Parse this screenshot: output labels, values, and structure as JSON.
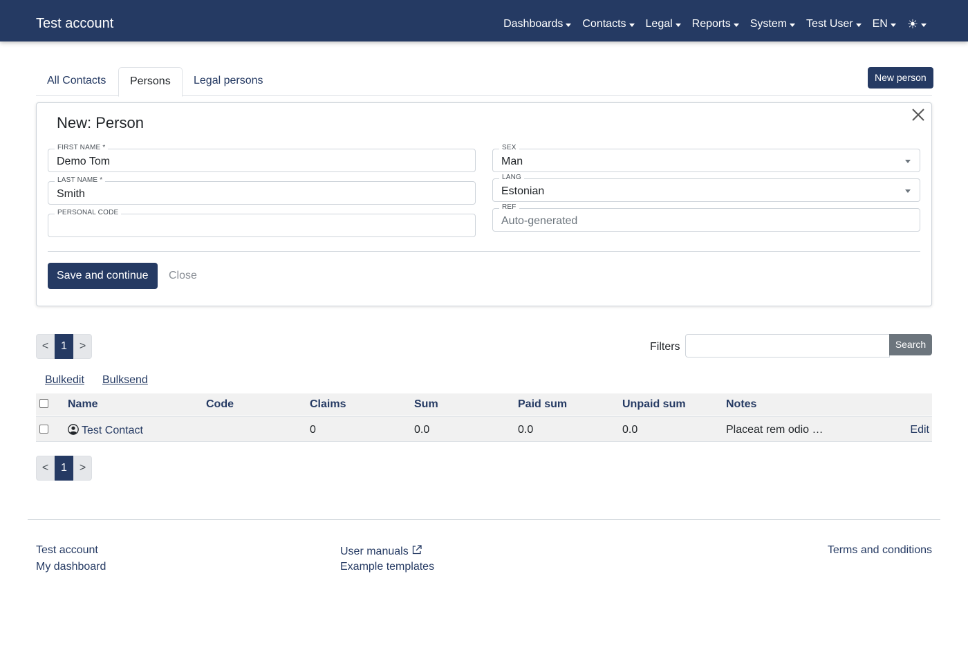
{
  "navbar": {
    "brand": "Test account",
    "items": [
      "Dashboards",
      "Contacts",
      "Legal",
      "Reports",
      "System",
      "Test User",
      "EN"
    ],
    "theme_icon": "sun-icon",
    "bg_color": "#253a63"
  },
  "tabs": {
    "all_contacts": "All Contacts",
    "persons": "Persons",
    "legal_persons": "Legal persons",
    "active": "Persons"
  },
  "new_person_button": "New person",
  "form": {
    "title": "New: Person",
    "first_name": {
      "label": "FIRST NAME *",
      "value": "Demo Tom"
    },
    "last_name": {
      "label": "LAST NAME *",
      "value": "Smith"
    },
    "personal_code": {
      "label": "PERSONAL CODE",
      "value": ""
    },
    "sex": {
      "label": "SEX",
      "value": "Man"
    },
    "lang": {
      "label": "LANG",
      "value": "Estonian"
    },
    "ref": {
      "label": "REF",
      "placeholder": "Auto-generated"
    },
    "save_button": "Save and continue",
    "close_button": "Close"
  },
  "pagination": {
    "prev": "<",
    "current": "1",
    "next": ">"
  },
  "filters": {
    "label": "Filters",
    "value": "",
    "search_button": "Search"
  },
  "actions": {
    "bulkedit": "Bulkedit",
    "bulksend": "Bulksend"
  },
  "table": {
    "columns": [
      "Name",
      "Code",
      "Claims",
      "Sum",
      "Paid sum",
      "Unpaid sum",
      "Notes"
    ],
    "rows": [
      {
        "name": "Test Contact",
        "code": "",
        "claims": "0",
        "sum": "0.0",
        "paid_sum": "0.0",
        "unpaid_sum": "0.0",
        "notes": "Placeat rem odio …",
        "edit": "Edit"
      }
    ]
  },
  "footer": {
    "test_account": "Test account",
    "my_dashboard": "My dashboard",
    "user_manuals": "User manuals",
    "example_templates": "Example templates",
    "terms": "Terms and conditions"
  }
}
